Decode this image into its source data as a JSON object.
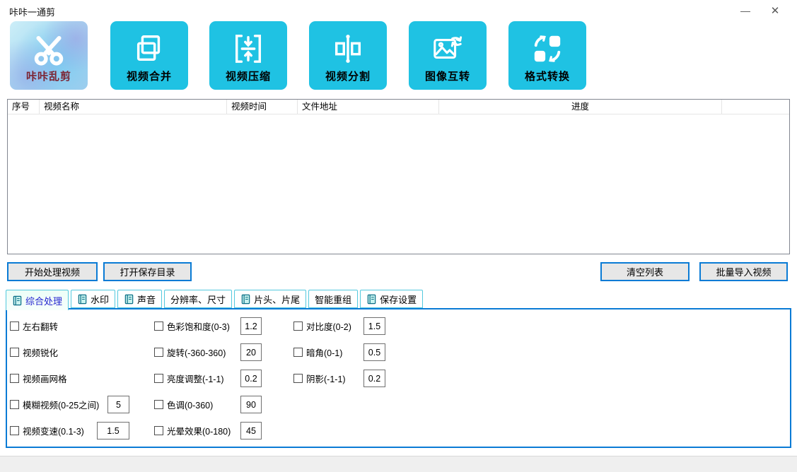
{
  "window": {
    "title": "咔咔一通剪",
    "minimize_glyph": "—",
    "close_glyph": "✕"
  },
  "toolbar": {
    "buttons": [
      {
        "label": "咔咔乱剪",
        "icon": "scissors-icon"
      },
      {
        "label": "视频合并",
        "icon": "merge-icon"
      },
      {
        "label": "视频压缩",
        "icon": "compress-icon"
      },
      {
        "label": "视频分割",
        "icon": "split-icon"
      },
      {
        "label": "图像互转",
        "icon": "image-convert-icon"
      },
      {
        "label": "格式转换",
        "icon": "format-convert-icon"
      }
    ]
  },
  "table": {
    "columns": [
      "序号",
      "视频名称",
      "视频时间",
      "文件地址",
      "进度"
    ],
    "rows": []
  },
  "actions": {
    "start": "开始处理视频",
    "open_dir": "打开保存目录",
    "clear": "清空列表",
    "import": "批量导入视频"
  },
  "tabs": [
    {
      "label": "综合处理",
      "active": true,
      "has_icon": true
    },
    {
      "label": "水印",
      "active": false,
      "has_icon": true
    },
    {
      "label": "声音",
      "active": false,
      "has_icon": true
    },
    {
      "label": "分辨率、尺寸",
      "active": false,
      "has_icon": false
    },
    {
      "label": "片头、片尾",
      "active": false,
      "has_icon": true
    },
    {
      "label": "智能重组",
      "active": false,
      "has_icon": false
    },
    {
      "label": "保存设置",
      "active": false,
      "has_icon": true
    }
  ],
  "settings": {
    "items": [
      {
        "label": "左右翻转",
        "checked": false
      },
      {
        "label": "色彩饱和度(0-3)",
        "checked": false,
        "value": "1.2"
      },
      {
        "label": "对比度(0-2)",
        "checked": false,
        "value": "1.5"
      },
      {
        "label": "视频锐化",
        "checked": false
      },
      {
        "label": "旋转(-360-360)",
        "checked": false,
        "value": "20"
      },
      {
        "label": "暗角(0-1)",
        "checked": false,
        "value": "0.5"
      },
      {
        "label": "视频画网格",
        "checked": false
      },
      {
        "label": "亮度调整(-1-1)",
        "checked": false,
        "value": "0.2"
      },
      {
        "label": "阴影(-1-1)",
        "checked": false,
        "value": "0.2"
      },
      {
        "label": "模糊视频(0-25之间)",
        "checked": false,
        "value": "5"
      },
      {
        "label": "色调(0-360)",
        "checked": false,
        "value": "90"
      },
      {
        "label": "视频变速(0.1-3)",
        "checked": false,
        "value": "1.5"
      },
      {
        "label": "光晕效果(0-180)",
        "checked": false,
        "value": "45"
      }
    ]
  },
  "colors": {
    "accent_cyan": "#1fc2e3",
    "accent_blue": "#0a7bd5",
    "tab_border": "#53c9de",
    "active_tab_text": "#2424cf",
    "kaka_text": "#7c2433"
  }
}
